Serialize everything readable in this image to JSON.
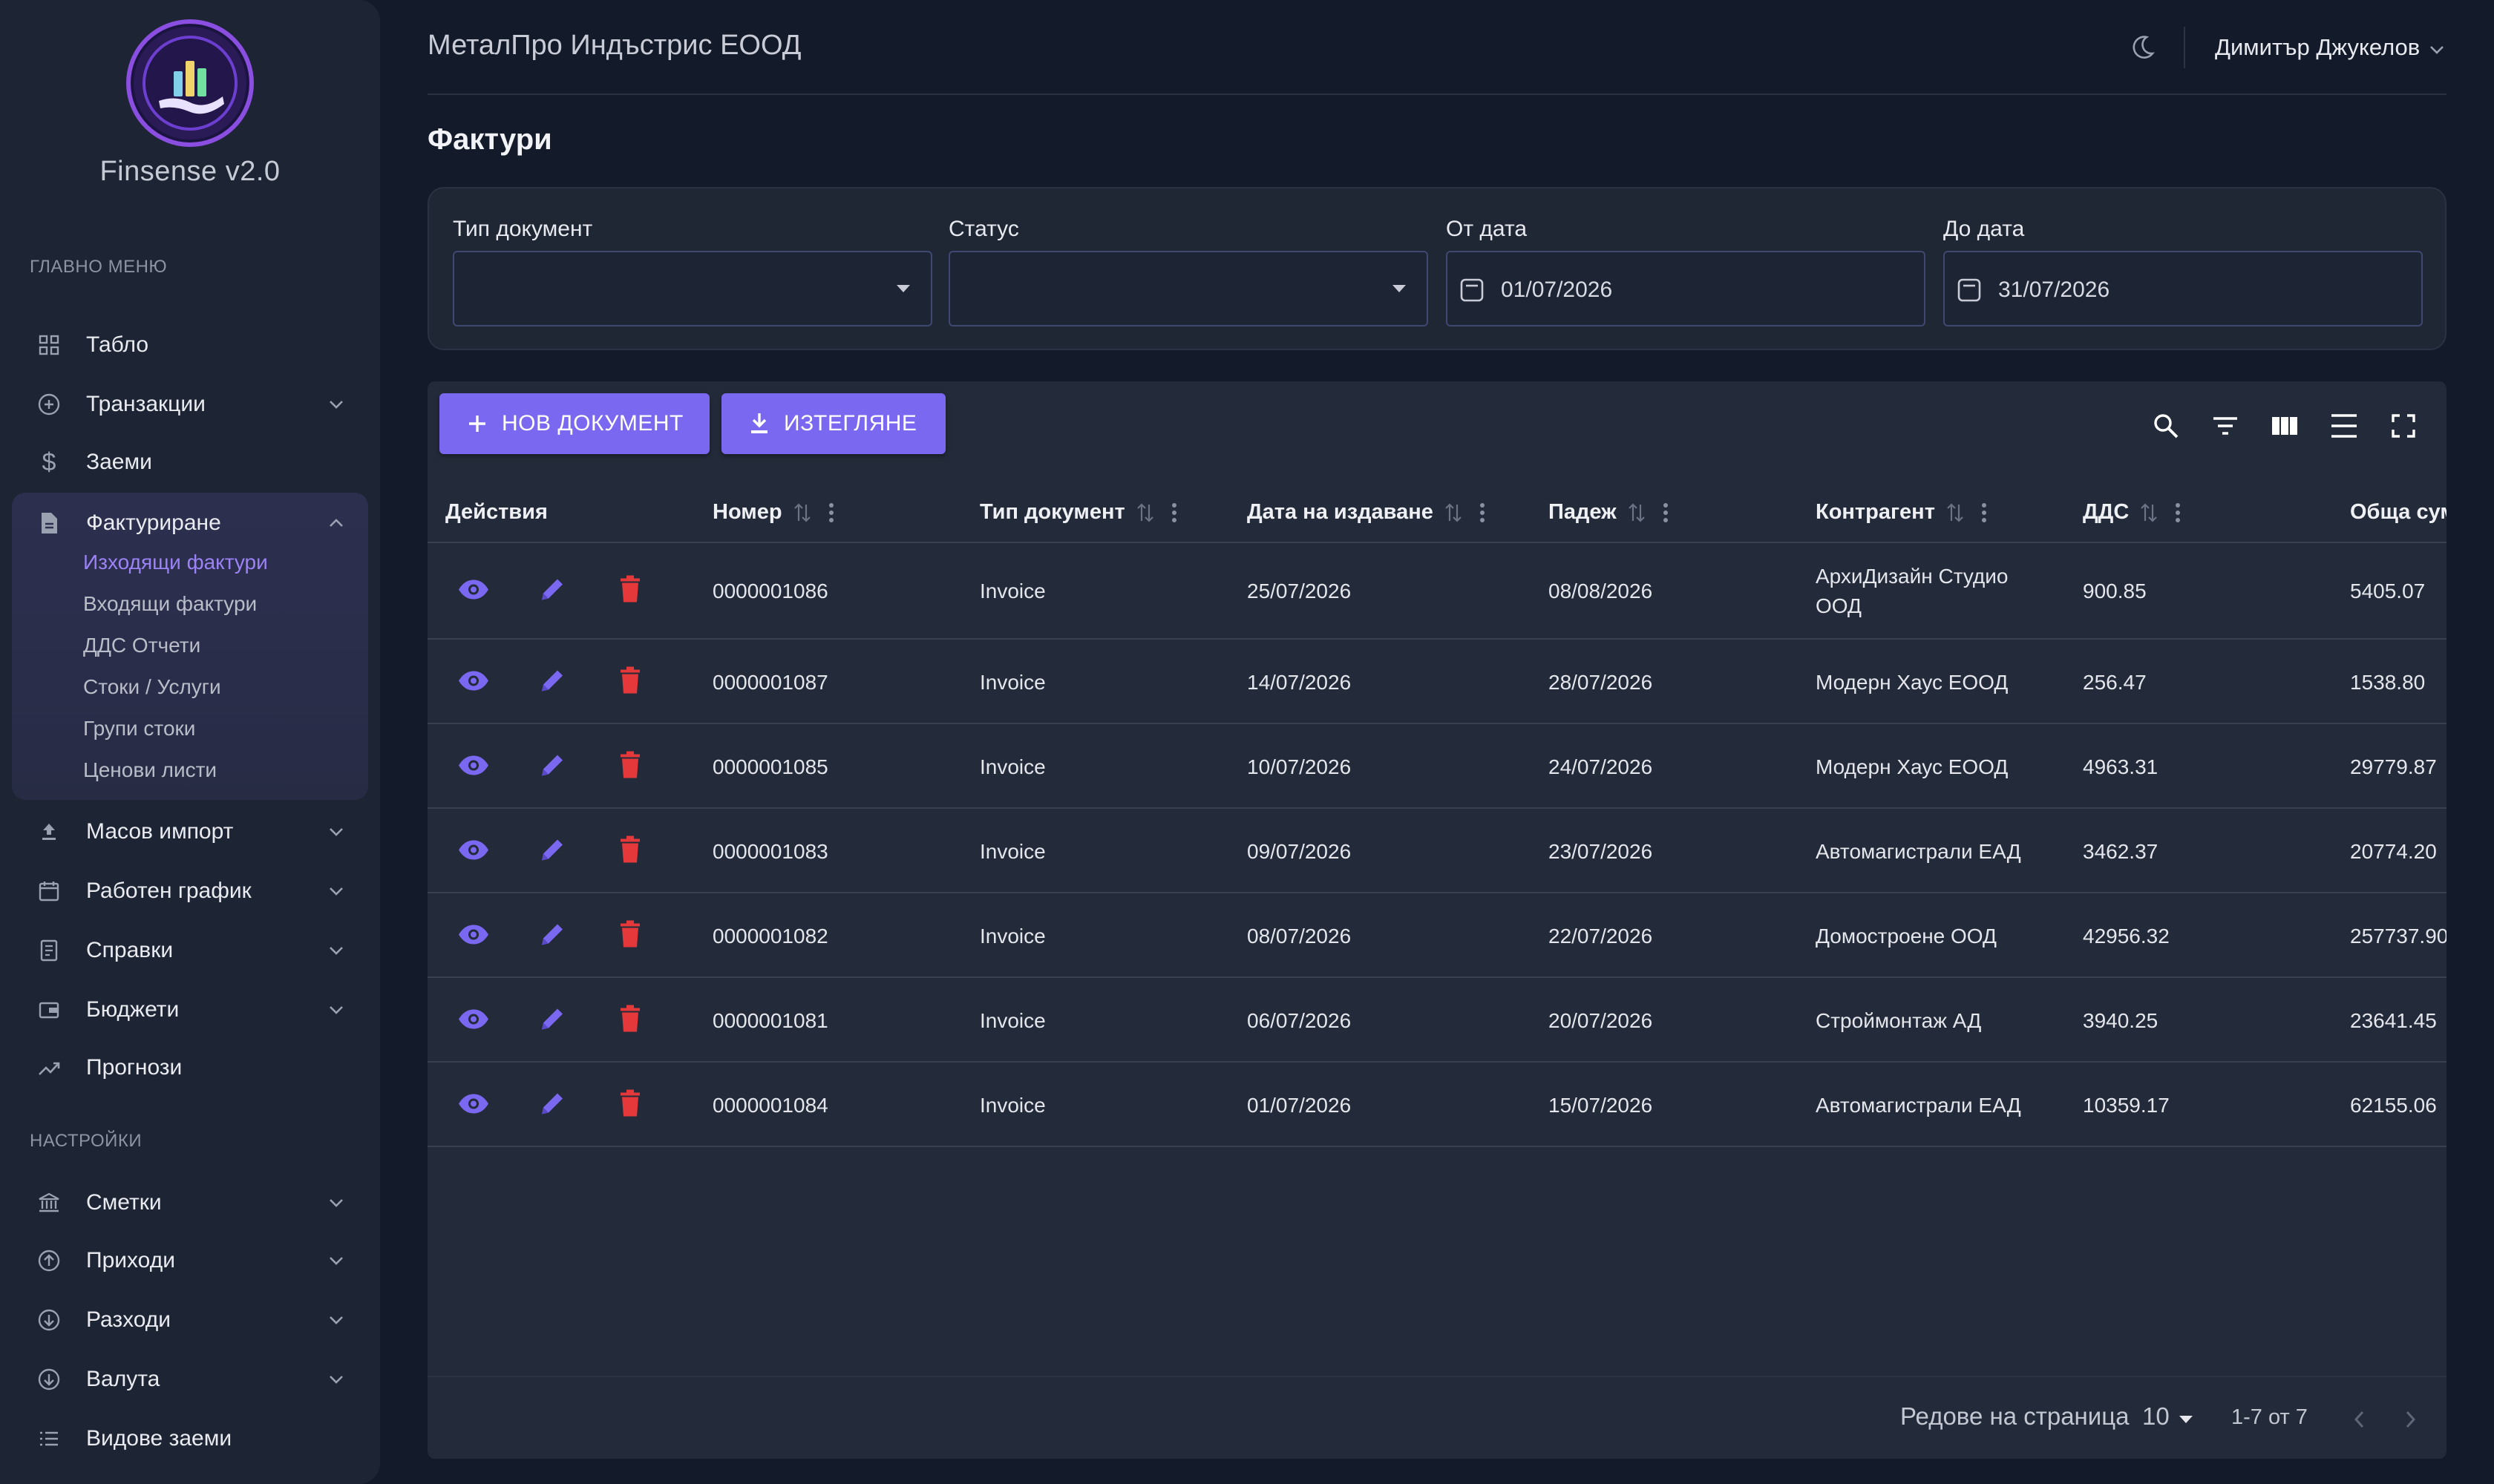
{
  "brand": {
    "name": "Finsense v2.0"
  },
  "sidebar": {
    "main_label": "ГЛАВНО МЕНЮ",
    "settings_label": "НАСТРОЙКИ",
    "items": [
      {
        "label": "Табло",
        "icon": "grid-icon"
      },
      {
        "label": "Транзакции",
        "icon": "plus-circle-icon"
      },
      {
        "label": "Заеми",
        "icon": "dollar-icon"
      },
      {
        "label": "Фактуриране",
        "icon": "document-icon"
      },
      {
        "label": "Масов импорт",
        "icon": "upload-icon"
      },
      {
        "label": "Работен график",
        "icon": "calendar-icon"
      },
      {
        "label": "Справки",
        "icon": "report-icon"
      },
      {
        "label": "Бюджети",
        "icon": "wallet-icon"
      },
      {
        "label": "Прогнози",
        "icon": "trend-icon"
      }
    ],
    "sub_items": [
      "Изходящи фактури",
      "Входящи фактури",
      "ДДС Отчети",
      "Стоки / Услуги",
      "Групи стоки",
      "Ценови листи"
    ],
    "settings_items": [
      {
        "label": "Сметки",
        "icon": "bank-icon"
      },
      {
        "label": "Приходи",
        "icon": "arrow-up-circle-icon"
      },
      {
        "label": "Разходи",
        "icon": "arrow-down-circle-icon"
      },
      {
        "label": "Валута",
        "icon": "currency-circle-icon"
      },
      {
        "label": "Видове заеми",
        "icon": "list-icon"
      }
    ]
  },
  "header": {
    "company": "МеталПро Индъстрис ЕООД",
    "user": "Димитър Джукелов",
    "page_title": "Фактури"
  },
  "filters": {
    "doc_type_label": "Тип документ",
    "status_label": "Статус",
    "from_label": "От дата",
    "from_value": "01/07/2026",
    "to_label": "До дата",
    "to_value": "31/07/2026"
  },
  "toolbar": {
    "new_label": "НОВ ДОКУМЕНТ",
    "download_label": "ИЗТЕГЛЯНЕ"
  },
  "table": {
    "columns": [
      "Действия",
      "Номер",
      "Тип документ",
      "Дата на издаване",
      "Падеж",
      "Контрагент",
      "ДДС",
      "Обща сума"
    ],
    "rows": [
      {
        "number": "0000001086",
        "type": "Invoice",
        "issued": "25/07/2026",
        "due": "08/08/2026",
        "partner": "АрхиДизайн Студио ООД",
        "vat": "900.85",
        "total": "5405.07"
      },
      {
        "number": "0000001087",
        "type": "Invoice",
        "issued": "14/07/2026",
        "due": "28/07/2026",
        "partner": "Модерн Хаус ЕООД",
        "vat": "256.47",
        "total": "1538.80"
      },
      {
        "number": "0000001085",
        "type": "Invoice",
        "issued": "10/07/2026",
        "due": "24/07/2026",
        "partner": "Модерн Хаус ЕООД",
        "vat": "4963.31",
        "total": "29779.87"
      },
      {
        "number": "0000001083",
        "type": "Invoice",
        "issued": "09/07/2026",
        "due": "23/07/2026",
        "partner": "Автомагистрали ЕАД",
        "vat": "3462.37",
        "total": "20774.20"
      },
      {
        "number": "0000001082",
        "type": "Invoice",
        "issued": "08/07/2026",
        "due": "22/07/2026",
        "partner": "Домостроене ООД",
        "vat": "42956.32",
        "total": "257737.90"
      },
      {
        "number": "0000001081",
        "type": "Invoice",
        "issued": "06/07/2026",
        "due": "20/07/2026",
        "partner": "Строймонтаж АД",
        "vat": "3940.25",
        "total": "23641.45"
      },
      {
        "number": "0000001084",
        "type": "Invoice",
        "issued": "01/07/2026",
        "due": "15/07/2026",
        "partner": "Автомагистрали ЕАД",
        "vat": "10359.17",
        "total": "62155.06"
      }
    ]
  },
  "pagination": {
    "rows_per_page_label": "Редове на страница",
    "rows_per_page": "10",
    "range": "1-7 от 7"
  },
  "colors": {
    "accent": "#7a68f0",
    "delete": "#e5383b",
    "active_text": "#9b82f5"
  }
}
